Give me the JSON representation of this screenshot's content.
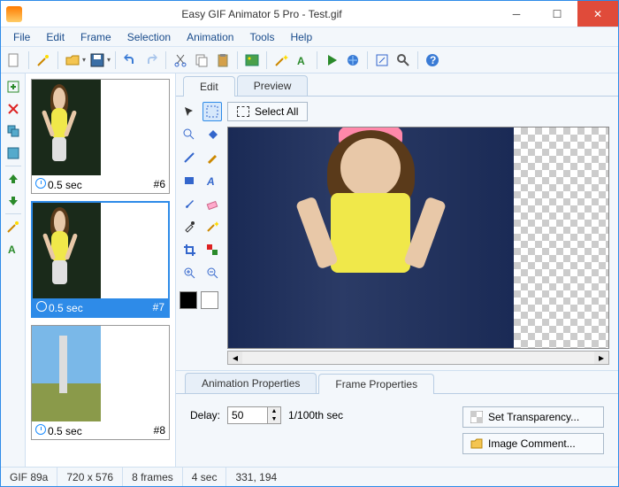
{
  "window": {
    "title": "Easy GIF Animator 5 Pro - Test.gif"
  },
  "menu": [
    "File",
    "Edit",
    "Frame",
    "Selection",
    "Animation",
    "Tools",
    "Help"
  ],
  "frames": [
    {
      "delay": "0.5 sec",
      "index": "#6",
      "selected": false
    },
    {
      "delay": "0.5 sec",
      "index": "#7",
      "selected": true
    },
    {
      "delay": "0.5 sec",
      "index": "#8",
      "selected": false
    }
  ],
  "tabs": {
    "edit": "Edit",
    "preview": "Preview"
  },
  "select_all": "Select All",
  "props": {
    "tab_anim": "Animation Properties",
    "tab_frame": "Frame Properties",
    "delay_label": "Delay:",
    "delay_value": "50",
    "delay_unit": "1/100th sec",
    "btn_transparency": "Set Transparency...",
    "btn_comment": "Image Comment..."
  },
  "status": {
    "format": "GIF 89a",
    "dims": "720 x 576",
    "frames": "8 frames",
    "duration": "4 sec",
    "coords": "331,  194"
  },
  "colors": {
    "fg": "#000000",
    "bg": "#ffffff"
  }
}
